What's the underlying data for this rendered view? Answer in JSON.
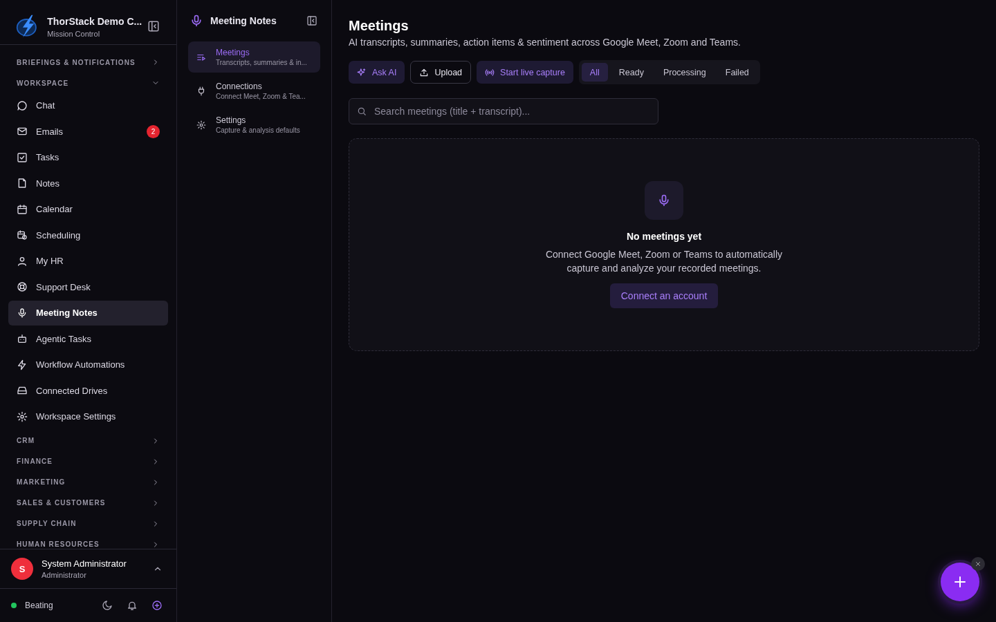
{
  "org": {
    "name": "ThorStack Demo C...",
    "subtitle": "Mission Control"
  },
  "nav": [
    {
      "label": "BRIEFINGS & NOTIFICATIONS",
      "expanded": false
    },
    {
      "label": "WORKSPACE",
      "expanded": true,
      "items": [
        {
          "label": "Chat",
          "selected": false
        },
        {
          "label": "Emails",
          "selected": false,
          "badge": "2"
        },
        {
          "label": "Tasks",
          "selected": false
        },
        {
          "label": "Notes",
          "selected": false
        },
        {
          "label": "Calendar",
          "selected": false
        },
        {
          "label": "Scheduling",
          "selected": false
        },
        {
          "label": "My HR",
          "selected": false
        },
        {
          "label": "Support Desk",
          "selected": false
        },
        {
          "label": "Meeting Notes",
          "selected": true
        },
        {
          "label": "Agentic Tasks",
          "selected": false
        },
        {
          "label": "Workflow Automations",
          "selected": false
        },
        {
          "label": "Connected Drives",
          "selected": false
        },
        {
          "label": "Workspace Settings",
          "selected": false
        }
      ]
    },
    {
      "label": "CRM",
      "expanded": false
    },
    {
      "label": "FINANCE",
      "expanded": false
    },
    {
      "label": "MARKETING",
      "expanded": false
    },
    {
      "label": "SALES & CUSTOMERS",
      "expanded": false
    },
    {
      "label": "SUPPLY CHAIN",
      "expanded": false
    },
    {
      "label": "HUMAN RESOURCES",
      "expanded": false
    }
  ],
  "user": {
    "initial": "S",
    "name": "System Administrator",
    "role": "Administrator"
  },
  "status": {
    "label": "Beating",
    "online": true
  },
  "subnav": {
    "title": "Meeting Notes",
    "items": [
      {
        "label": "Meetings",
        "description": "Transcripts, summaries & in...",
        "selected": true
      },
      {
        "label": "Connections",
        "description": "Connect Meet, Zoom & Tea...",
        "selected": false
      },
      {
        "label": "Settings",
        "description": "Capture & analysis defaults",
        "selected": false
      }
    ]
  },
  "page": {
    "title": "Meetings",
    "subtitle": "AI transcripts, summaries, action items & sentiment across Google Meet, Zoom and Teams."
  },
  "actions": [
    {
      "label": "Ask AI",
      "kind": "accent"
    },
    {
      "label": "Upload",
      "kind": "outline"
    },
    {
      "label": "Start live capture",
      "kind": "accent"
    }
  ],
  "filters": [
    {
      "label": "All",
      "selected": true
    },
    {
      "label": "Ready",
      "selected": false
    },
    {
      "label": "Processing",
      "selected": false
    },
    {
      "label": "Failed",
      "selected": false
    }
  ],
  "search": {
    "placeholder": "Search meetings (title + transcript)..."
  },
  "empty": {
    "title": "No meetings yet",
    "text": "Connect Google Meet, Zoom or Teams to automatically capture and analyze your recorded meetings.",
    "button": "Connect an account"
  }
}
